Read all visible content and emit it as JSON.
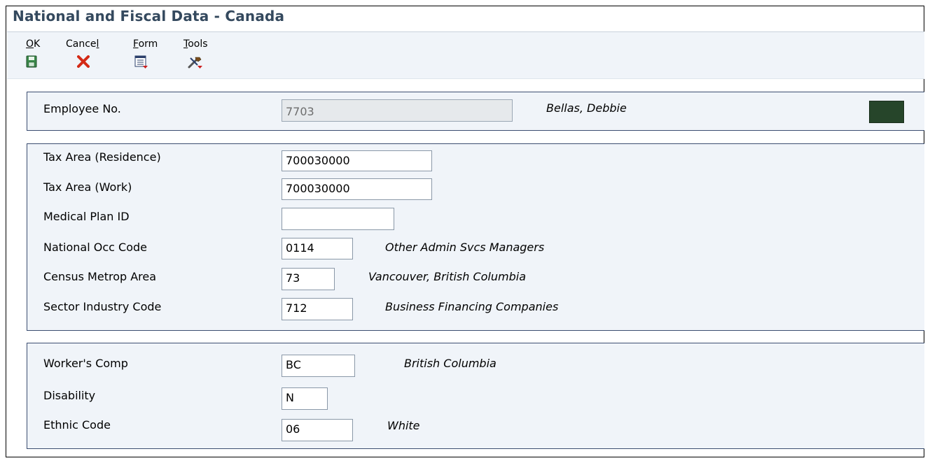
{
  "window": {
    "title": "National and Fiscal Data - Canada"
  },
  "toolbar": {
    "ok": {
      "label": "OK",
      "hotkey": "O",
      "rest": "K",
      "icon": "save-icon"
    },
    "cancel": {
      "label": "Cancel",
      "pre": "Cance",
      "hotkey": "l",
      "icon": "close-icon"
    },
    "form": {
      "label": "Form",
      "hotkey": "F",
      "rest": "orm",
      "icon": "form-menu-icon"
    },
    "tools": {
      "label": "Tools",
      "hotkey": "T",
      "rest": "ools",
      "icon": "tools-menu-icon"
    }
  },
  "employee": {
    "label": "Employee No.",
    "value": "7703",
    "name": "Bellas, Debbie",
    "indicator_color": "#26452a"
  },
  "tax": {
    "residence": {
      "label": "Tax Area (Residence)",
      "value": "700030000"
    },
    "work": {
      "label": "Tax Area (Work)",
      "value": "700030000"
    },
    "medical": {
      "label": "Medical Plan ID",
      "value": ""
    },
    "occ": {
      "label": "National Occ Code",
      "value": "0114",
      "desc": "Other Admin Svcs Managers"
    },
    "census": {
      "label": "Census Metrop Area",
      "value": "73",
      "desc": "Vancouver, British Columbia"
    },
    "sector": {
      "label": "Sector Industry Code",
      "value": "712",
      "desc": "Business Financing Companies"
    }
  },
  "other": {
    "workers_comp": {
      "label": "Worker's Comp",
      "value": "BC",
      "desc": "British Columbia"
    },
    "disability": {
      "label": "Disability",
      "value": "N"
    },
    "ethnic": {
      "label": "Ethnic Code",
      "value": "06",
      "desc": "White"
    }
  }
}
